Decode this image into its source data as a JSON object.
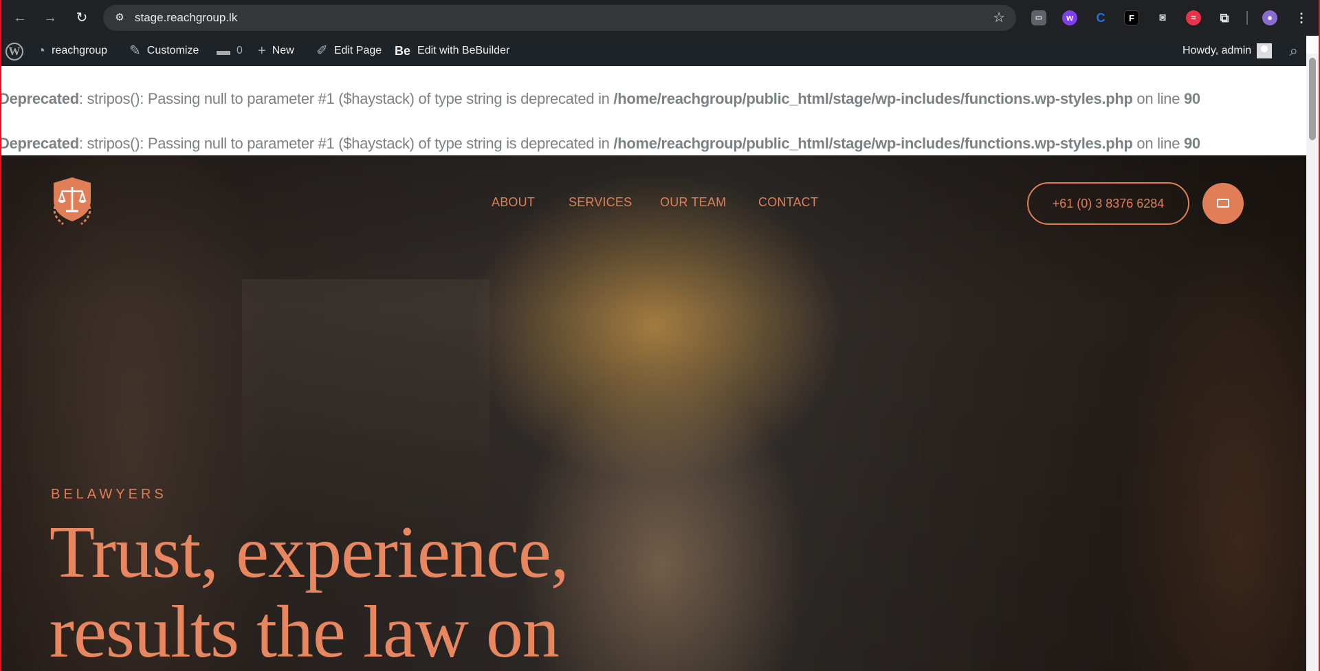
{
  "browser": {
    "url": "stage.reachgroup.lk",
    "extensions": [
      "tab-search-icon",
      "wp-ext-icon",
      "c-ext-icon",
      "f-ext-icon",
      "camera-icon",
      "red-ext-icon",
      "puzzle-icon",
      "profile-avatar"
    ]
  },
  "adminbar": {
    "site_name": "reachgroup",
    "customize": "Customize",
    "comments_count": "0",
    "new": "New",
    "edit_page": "Edit Page",
    "be_logo": "Be",
    "edit_bebuilder": "Edit with BeBuilder",
    "howdy": "Howdy, admin"
  },
  "notices": [
    {
      "label": "Deprecated",
      "message": ": stripos(): Passing null to parameter #1 ($haystack) of type string is deprecated in ",
      "path": "/home/reachgroup/public_html/stage/wp-includes/functions.wp-styles.php",
      "on_line": " on line ",
      "line": "90"
    },
    {
      "label": "Deprecated",
      "message": ": stripos(): Passing null to parameter #1 ($haystack) of type string is deprecated in ",
      "path": "/home/reachgroup/public_html/stage/wp-includes/functions.wp-styles.php",
      "on_line": " on line ",
      "line": "90"
    }
  ],
  "site": {
    "menu": [
      "ABOUT",
      "SERVICES",
      "OUR TEAM",
      "CONTACT"
    ],
    "phone": "+61 (0) 3 8376 6284",
    "eyebrow": "BELAWYERS",
    "headline_line1": "Trust, experience,",
    "headline_line2": "results the law on",
    "accent_color": "#e07f57"
  }
}
